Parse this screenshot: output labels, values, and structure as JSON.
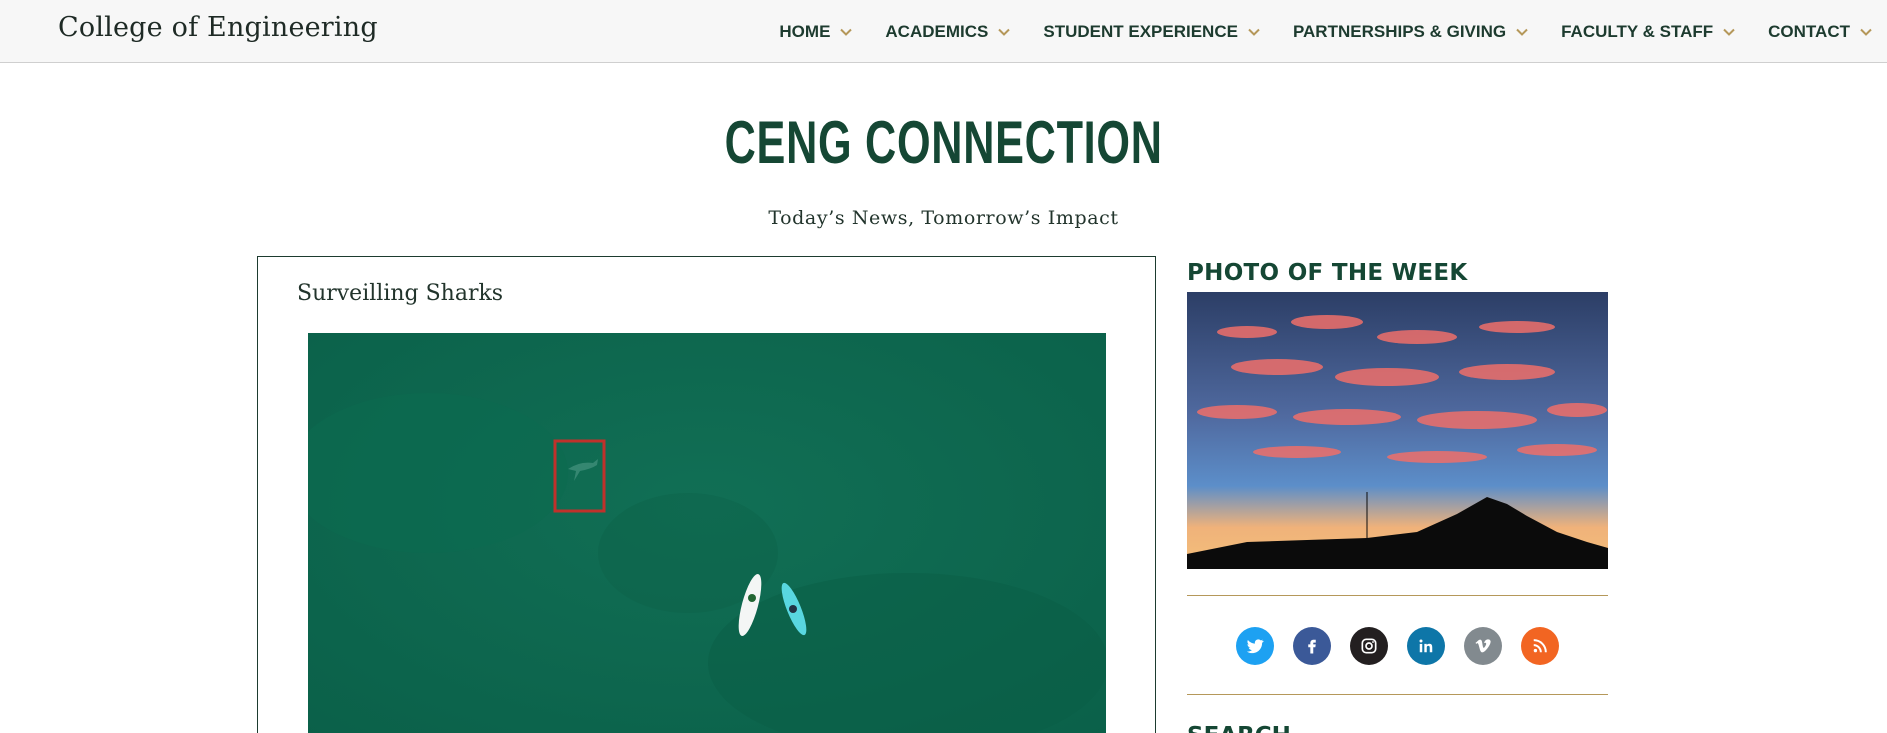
{
  "header": {
    "site_title": "College of Engineering",
    "nav": [
      {
        "label": "HOME"
      },
      {
        "label": "ACADEMICS"
      },
      {
        "label": "STUDENT EXPERIENCE"
      },
      {
        "label": "PARTNERSHIPS & GIVING"
      },
      {
        "label": "FACULTY & STAFF"
      },
      {
        "label": "CONTACT"
      }
    ]
  },
  "masthead": {
    "title": "CENG CONNECTION",
    "subtitle": "Today’s News, Tomorrow’s Impact"
  },
  "article": {
    "title": "Surveilling Sharks"
  },
  "sidebar": {
    "photo_title": "PHOTO OF THE WEEK",
    "search_title": "SEARCH",
    "social": [
      {
        "icon": "twitter-icon",
        "color": "#1da1f2"
      },
      {
        "icon": "facebook-icon",
        "color": "#3b5998"
      },
      {
        "icon": "instagram-icon",
        "color": "#231f20"
      },
      {
        "icon": "linkedin-icon",
        "color": "#0e76a8"
      },
      {
        "icon": "vimeo-icon",
        "color": "#828a8f"
      },
      {
        "icon": "rss-icon",
        "color": "#f26522"
      }
    ]
  },
  "colors": {
    "brand_green": "#154734",
    "gold": "#b5985a"
  }
}
